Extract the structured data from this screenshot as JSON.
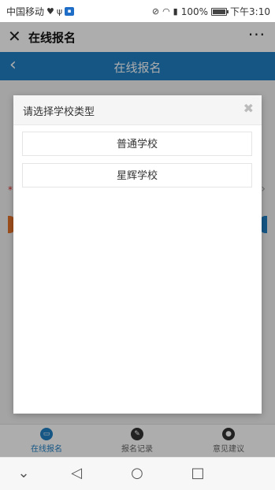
{
  "status_bar": {
    "carrier": "中国移动",
    "battery": "100%",
    "time": "下午3:10"
  },
  "wechat_header": {
    "close_glyph": "✕",
    "title": "在线报名",
    "more_glyph": "···"
  },
  "app_bar": {
    "back_glyph": "‹",
    "title": "在线报名"
  },
  "modal": {
    "title": "请选择学校类型",
    "close_glyph": "✖",
    "options": [
      {
        "label": "普通学校"
      },
      {
        "label": "星辉学校"
      }
    ]
  },
  "bottom_nav": {
    "items": [
      {
        "label": "在线报名",
        "icon": "monitor-icon",
        "active": true
      },
      {
        "label": "报名记录",
        "icon": "pencil-icon",
        "active": false
      },
      {
        "label": "意见建议",
        "icon": "person-icon",
        "active": false
      }
    ]
  },
  "android_nav": {
    "down": "⌄",
    "back": "◁",
    "home": "○",
    "recents": "□"
  },
  "colors": {
    "brand_blue": "#1f7fc4",
    "accent_orange": "#e8742a"
  }
}
